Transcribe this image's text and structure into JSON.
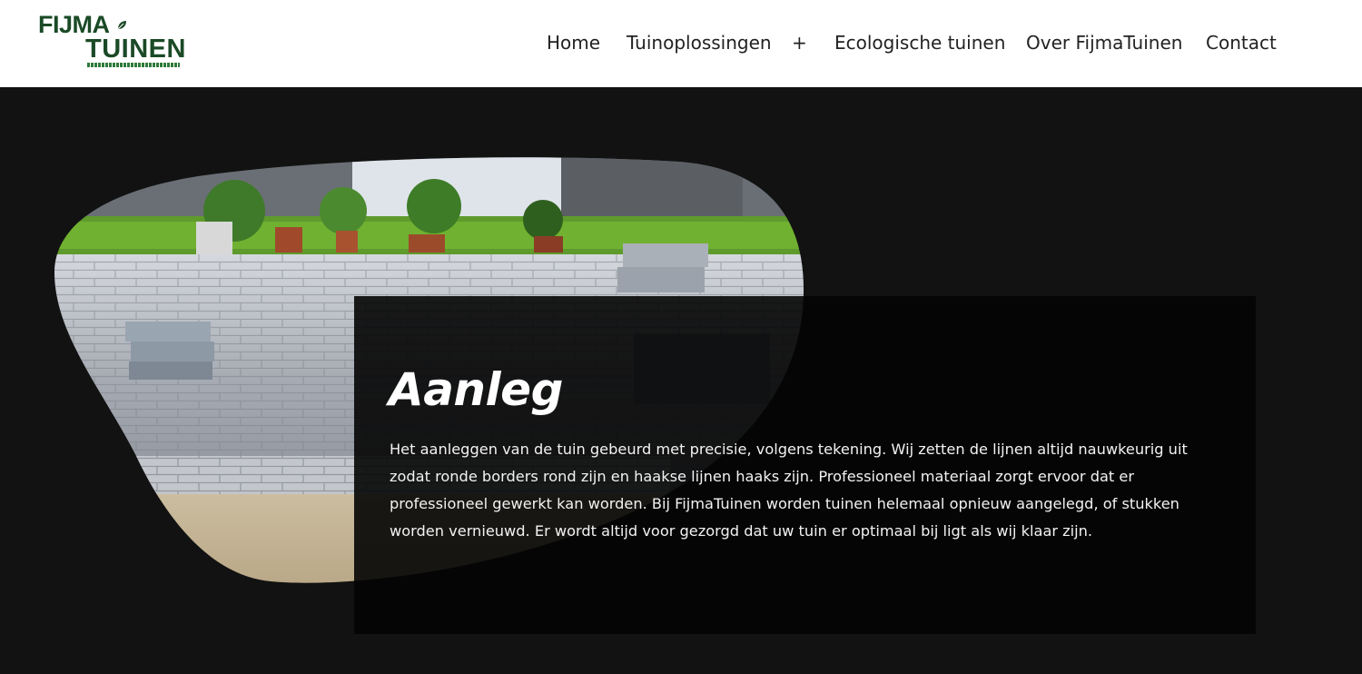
{
  "logo": {
    "line1": "FIJMA",
    "line2": "TUINEN"
  },
  "nav": {
    "home": "Home",
    "tuinoplossingen": "Tuinoplossingen",
    "expand": "+",
    "ecologische": "Ecologische tuinen",
    "over": "Over FijmaTuinen",
    "contact": "Contact"
  },
  "hero": {
    "title": "Aanleg",
    "text": "Het aanleggen van de tuin gebeurd met precisie, volgens tekening. Wij zetten de lijnen altijd nauwkeurig uit zodat ronde borders rond zijn en haakse lijnen haaks zijn. Professioneel materiaal zorgt ervoor dat er professioneel gewerkt kan worden. Bij FijmaTuinen worden tuinen helemaal opnieuw aangelegd, of stukken worden vernieuwd. Er wordt altijd voor gezorgd dat uw tuin er optimaal bij ligt als wij klaar zijn."
  },
  "colors": {
    "brand_green": "#1a4a26",
    "page_background": "#121212",
    "header_background": "#ffffff"
  }
}
